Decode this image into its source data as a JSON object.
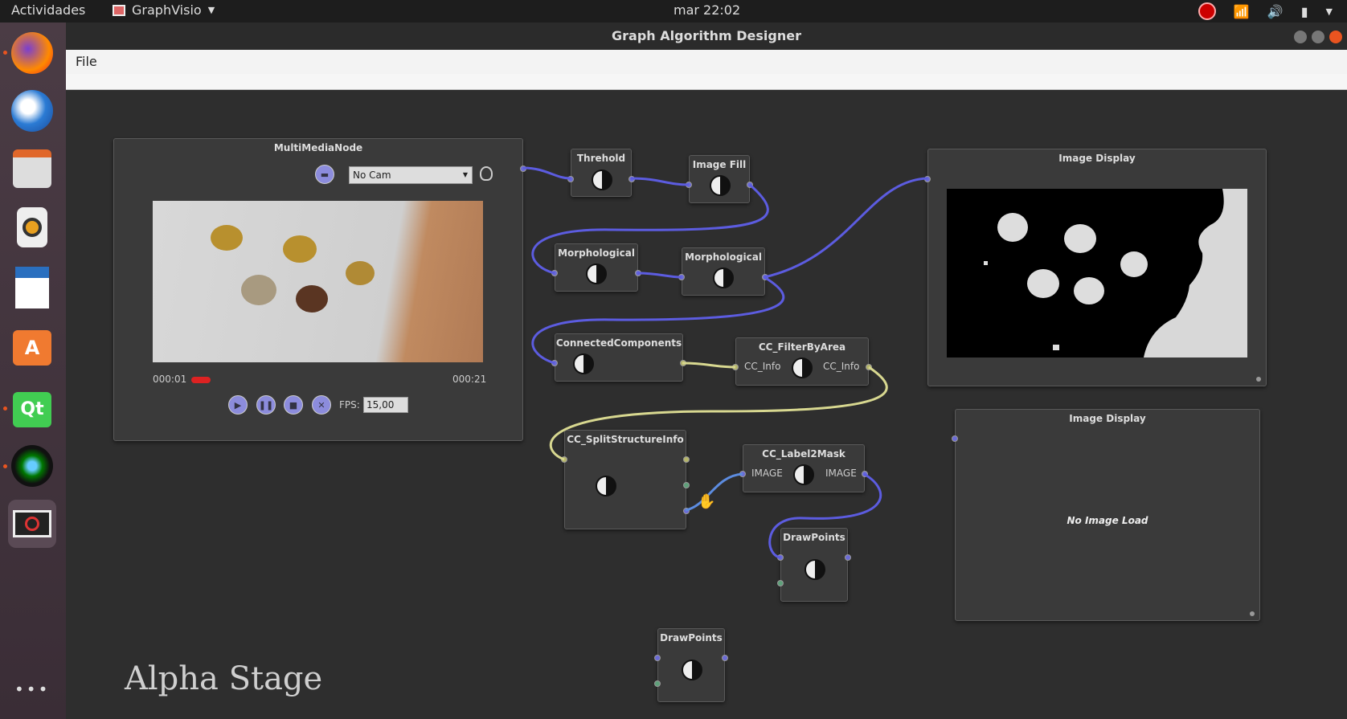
{
  "system": {
    "activities": "Actividades",
    "app_name": "GraphVisio",
    "clock": "mar 22:02"
  },
  "window": {
    "title": "Graph Algorithm Designer",
    "menu_file": "File"
  },
  "multimedia": {
    "title": "MultiMediaNode",
    "source": "No Cam",
    "time_current": "000:01",
    "time_total": "000:21",
    "fps_label": "FPS:",
    "fps_value": "15,00"
  },
  "nodes": {
    "threhold": "Threhold",
    "image_fill": "Image Fill",
    "morph1": "Morphological",
    "morph2": "Morphological",
    "cc": "ConnectedComponents",
    "cc_filter": "CC_FilterByArea",
    "cc_filter_in": "CC_Info",
    "cc_filter_out": "CC_Info",
    "cc_split": "CC_SplitStructureInfo",
    "cc_label": "CC_Label2Mask",
    "cc_label_in": "IMAGE",
    "cc_label_out": "IMAGE",
    "draw1": "DrawPoints",
    "draw2": "DrawPoints"
  },
  "display1": {
    "title": "Image Display"
  },
  "display2": {
    "title": "Image Display",
    "empty": "No Image Load"
  },
  "watermark": "Alpha Stage",
  "colors": {
    "wire_blue": "#5c5ce0",
    "wire_yellow": "#d8d890",
    "accent": "#e95420"
  }
}
